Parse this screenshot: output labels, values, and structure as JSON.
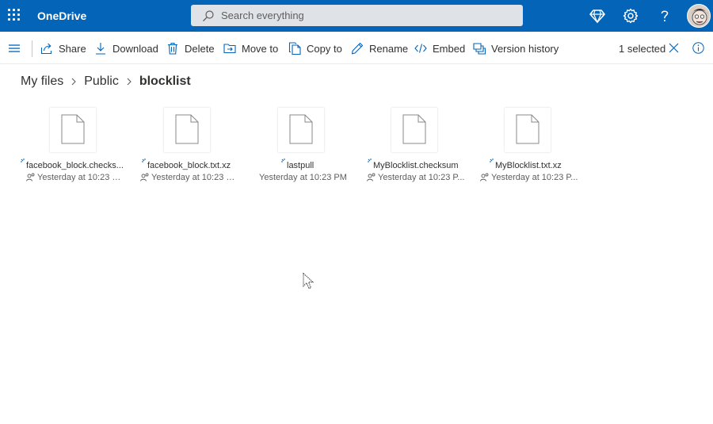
{
  "app": {
    "title": "OneDrive",
    "accent": "#0364b8"
  },
  "topbar": {
    "search_placeholder": "Search everything",
    "icons": [
      "app-launcher-icon",
      "search-icon",
      "premium-diamond-icon",
      "gear-icon",
      "help-icon",
      "avatar"
    ]
  },
  "toolbar": {
    "share": "Share",
    "download": "Download",
    "delete": "Delete",
    "move_to": "Move to",
    "copy_to": "Copy to",
    "rename": "Rename",
    "embed": "Embed",
    "version_history": "Version history",
    "selected": "1 selected"
  },
  "breadcrumb": [
    "My files",
    "Public",
    "blocklist"
  ],
  "files": [
    {
      "name": "facebook_block.checksum",
      "name_display": "facebook_block.checks...",
      "meta": "Yesterday at 10:23 P...",
      "shared": true
    },
    {
      "name": "facebook_block.txt.xz",
      "name_display": "facebook_block.txt.xz",
      "meta": "Yesterday at 10:23 P...",
      "shared": true
    },
    {
      "name": "lastpull",
      "name_display": "lastpull",
      "meta": "Yesterday at 10:23 PM",
      "shared": false
    },
    {
      "name": "MyBlocklist.checksum",
      "name_display": "MyBlocklist.checksum",
      "meta": "Yesterday at 10:23 P...",
      "shared": true
    },
    {
      "name": "MyBlocklist.txt.xz",
      "name_display": "MyBlocklist.txt.xz",
      "meta": "Yesterday at 10:23 P...",
      "shared": true
    }
  ]
}
